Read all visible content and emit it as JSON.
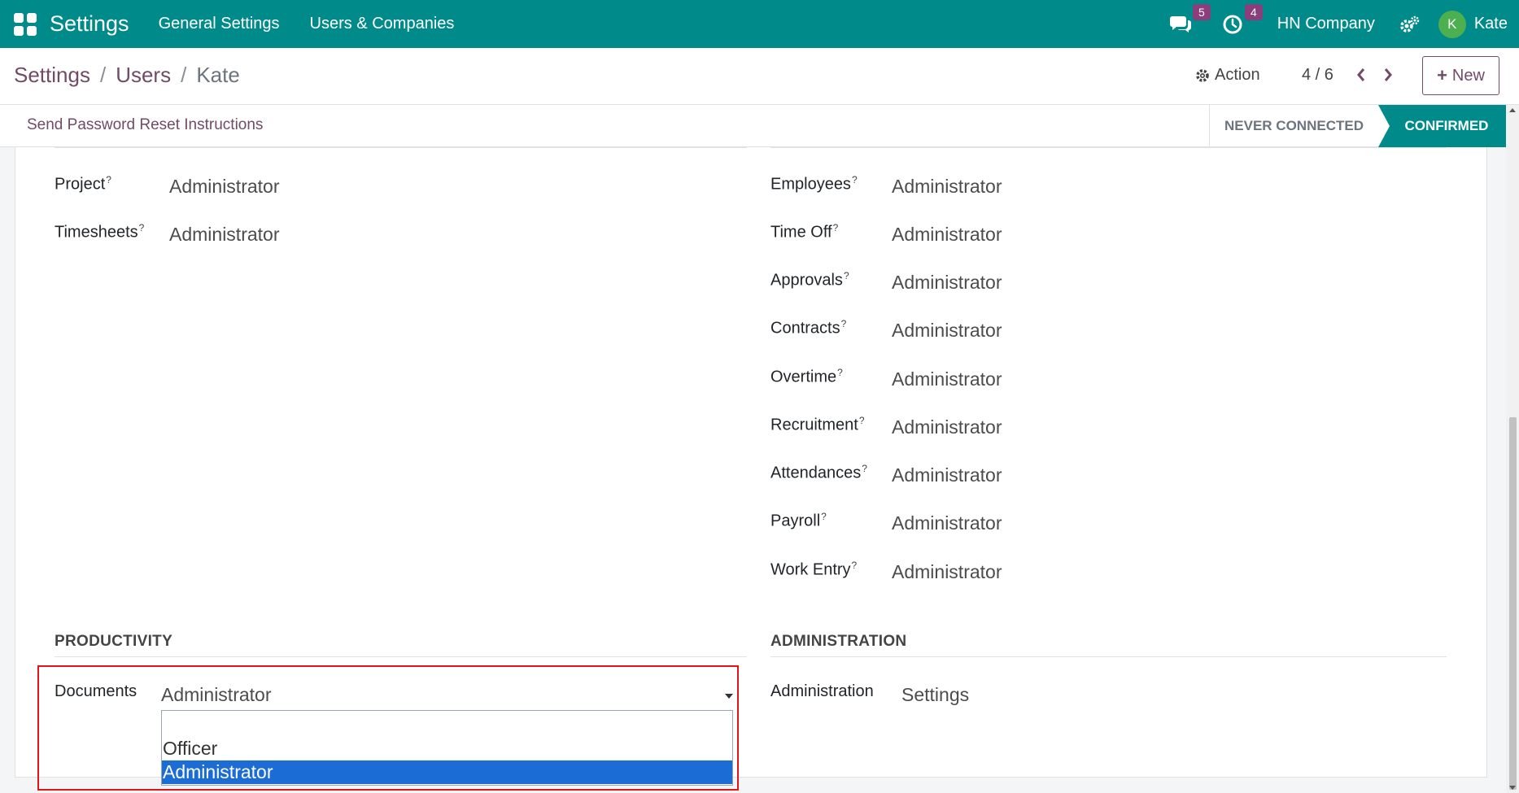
{
  "navbar": {
    "app_title": "Settings",
    "menu": [
      "General Settings",
      "Users & Companies"
    ],
    "messages_badge": "5",
    "activities_badge": "4",
    "company": "HN Company",
    "avatar_initial": "K",
    "user": "Kate",
    "color": "#018a8a"
  },
  "breadcrumb": {
    "items": [
      "Settings",
      "Users"
    ],
    "separator": "/",
    "current": "Kate"
  },
  "control": {
    "action_label": "Action",
    "pager": "4 / 6",
    "new_label": "New"
  },
  "statusbar": {
    "reset_label": "Send Password Reset Instructions",
    "stages": [
      "NEVER CONNECTED",
      "CONFIRMED"
    ],
    "active_stage": "CONFIRMED"
  },
  "left_fields": [
    {
      "label": "Project",
      "help": "?",
      "value": "Administrator"
    },
    {
      "label": "Timesheets",
      "help": "?",
      "value": "Administrator"
    }
  ],
  "right_fields": [
    {
      "label": "Employees",
      "help": "?",
      "value": "Administrator"
    },
    {
      "label": "Time Off",
      "help": "?",
      "value": "Administrator"
    },
    {
      "label": "Approvals",
      "help": "?",
      "value": "Administrator"
    },
    {
      "label": "Contracts",
      "help": "?",
      "value": "Administrator"
    },
    {
      "label": "Overtime",
      "help": "?",
      "value": "Administrator"
    },
    {
      "label": "Recruitment",
      "help": "?",
      "value": "Administrator"
    },
    {
      "label": "Attendances",
      "help": "?",
      "value": "Administrator"
    },
    {
      "label": "Payroll",
      "help": "?",
      "value": "Administrator"
    },
    {
      "label": "Work Entry",
      "help": "?",
      "value": "Administrator"
    }
  ],
  "productivity": {
    "title": "PRODUCTIVITY",
    "field_label": "Documents",
    "selected": "Administrator",
    "options": [
      "",
      "Officer",
      "Administrator"
    ],
    "highlighted_option": "Administrator"
  },
  "administration": {
    "title": "ADMINISTRATION",
    "field_label": "Administration",
    "value": "Settings"
  },
  "colors": {
    "brand": "#018a8a",
    "link": "#714b67",
    "badge": "#8c3d7c",
    "selection": "#1c6cd6",
    "highlight_border": "#e0161b"
  },
  "icons": [
    "apps-grid-icon",
    "chat-icon",
    "clock-icon",
    "gears-icon",
    "gear-icon",
    "chevron-left-icon",
    "chevron-right-icon",
    "plus-icon"
  ]
}
